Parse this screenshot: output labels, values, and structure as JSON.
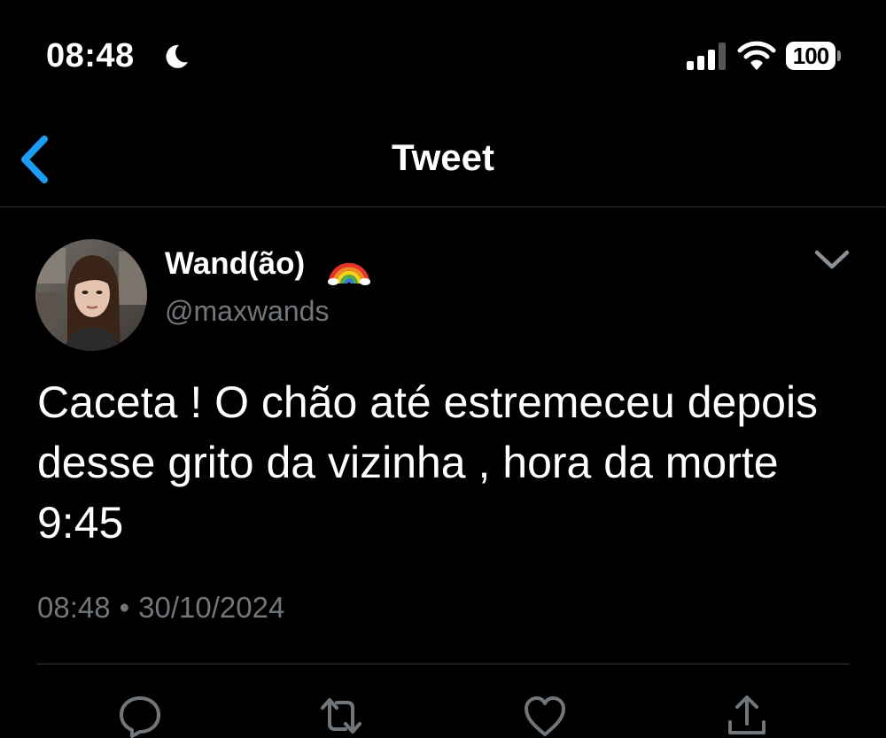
{
  "status_bar": {
    "time": "08:48",
    "battery": "100"
  },
  "nav": {
    "title": "Tweet"
  },
  "tweet": {
    "display_name": "Wand(ão)",
    "username": "@maxwands",
    "text": "Caceta ! O chão até estremeceu depois desse grito da vizinha , hora da morte 9:45",
    "time": "08:48",
    "separator": "•",
    "date": "30/10/2024"
  },
  "icons": {
    "status": [
      "moon-icon",
      "signal-icon",
      "wifi-icon",
      "battery-icon"
    ],
    "nav": [
      "chevron-left-icon"
    ],
    "header": [
      "rainbow-icon",
      "chevron-down-icon"
    ],
    "actions": [
      "reply-icon",
      "retweet-icon",
      "like-icon",
      "share-icon"
    ]
  },
  "colors": {
    "background": "#000000",
    "accent": "#1d9bf0",
    "secondary_text": "#71767b",
    "divider": "#2f3336",
    "action_icons": "#71767b"
  }
}
